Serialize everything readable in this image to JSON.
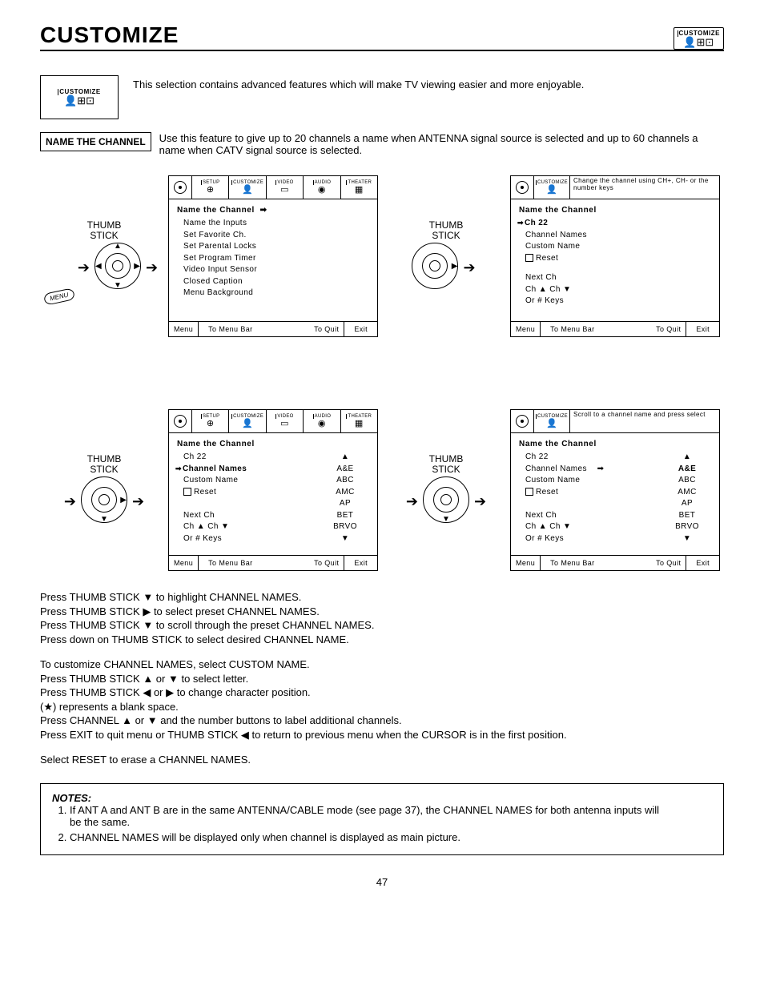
{
  "page": {
    "title": "CUSTOMIZE",
    "number": "47"
  },
  "icon_label": "CUSTOMIZE",
  "intro": "This selection contains advanced features which will make TV viewing easier and more enjoyable.",
  "section": {
    "label": "NAME THE CHANNEL",
    "text": "Use this feature to give up to 20 channels a name when ANTENNA signal source is selected and up to 60 channels a name when CATV signal source is selected."
  },
  "thumb": "THUMB STICK",
  "menu_btn": "MENU",
  "tabs": [
    "SETUP",
    "CUSTOMIZE",
    "VIDEO",
    "AUDIO",
    "THEATER"
  ],
  "step1": {
    "heading": "Name the Channel",
    "items": [
      "Name the Channel",
      "Name the Inputs",
      "Set Favorite Ch.",
      "Set Parental Locks",
      "Set Program Timer",
      "Video Input Sensor",
      "Closed Caption",
      "Menu Background"
    ]
  },
  "step2": {
    "tab_hint": "Change the channel using CH+, CH- or the number keys",
    "heading": "Name the Channel",
    "items_a": [
      "Ch 22",
      "Channel Names",
      "Custom Name",
      "Reset"
    ],
    "items_b": [
      "Next Ch",
      "Ch ▲ Ch ▼",
      "Or # Keys"
    ]
  },
  "step3": {
    "heading": "Name the Channel",
    "left": [
      "Ch 22",
      "Channel Names",
      "Custom Name",
      "Reset",
      "",
      "Next Ch",
      "Ch ▲ Ch ▼",
      "Or # Keys"
    ],
    "right": [
      "▲",
      "A&E",
      "ABC",
      "AMC",
      "AP",
      "BET",
      "BRVO",
      "▼"
    ]
  },
  "step4": {
    "tab_hint": "Scroll to a channel name and press select",
    "heading": "Name the Channel",
    "left": [
      "Ch 22",
      "Channel Names",
      "Custom Name",
      "Reset",
      "",
      "Next Ch",
      "Ch ▲ Ch ▼",
      "Or # Keys"
    ],
    "right": [
      "▲",
      "A&E",
      "ABC",
      "AMC",
      "AP",
      "BET",
      "BRVO",
      "▼"
    ],
    "sel_right": "A&E"
  },
  "footer": {
    "menu": "Menu",
    "tomenu": "To Menu Bar",
    "toquit": "To Quit",
    "exit": "Exit"
  },
  "instructions": {
    "block1": [
      "Press THUMB STICK  ▼ to highlight CHANNEL NAMES.",
      "Press THUMB STICK ▶ to select preset CHANNEL NAMES.",
      "Press THUMB STICK ▼ to scroll through the preset CHANNEL NAMES.",
      "Press down on THUMB STICK to select desired CHANNEL NAME."
    ],
    "block2": [
      "To customize CHANNEL NAMES, select CUSTOM NAME.",
      "Press THUMB STICK ▲ or ▼ to select letter.",
      "Press THUMB STICK ◀ or ▶ to change character position.",
      "(★) represents a blank space.",
      "Press CHANNEL ▲ or ▼  and the number buttons to label additional channels.",
      "Press EXIT to quit menu or THUMB STICK ◀ to return to previous menu when the CURSOR is in the first position."
    ],
    "block3": [
      "Select RESET to erase a CHANNEL NAMES."
    ]
  },
  "notes": {
    "label": "NOTES:",
    "items": [
      "If ANT A and ANT B are in the same ANTENNA/CABLE mode (see page 37), the CHANNEL NAMES for both antenna inputs will be the same.",
      "CHANNEL NAMES will be displayed only when channel is displayed as main picture."
    ]
  }
}
